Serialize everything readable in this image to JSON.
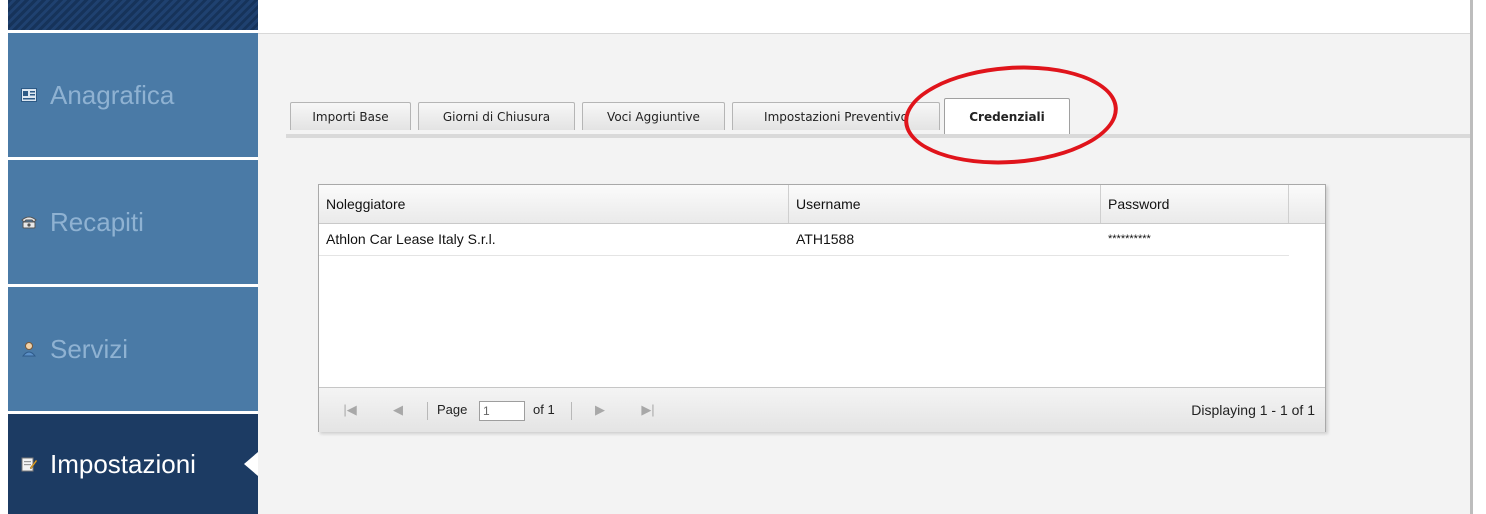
{
  "sidebar": {
    "items": [
      {
        "label": "Anagrafica",
        "icon": "id-card-icon"
      },
      {
        "label": "Recapiti",
        "icon": "phone-icon"
      },
      {
        "label": "Servizi",
        "icon": "person-icon"
      },
      {
        "label": "Impostazioni",
        "icon": "edit-note-icon",
        "active": true
      }
    ]
  },
  "tabs": [
    {
      "label": "Importi Base"
    },
    {
      "label": "Giorni di Chiusura"
    },
    {
      "label": "Voci Aggiuntive"
    },
    {
      "label": "Impostazioni Preventivo"
    },
    {
      "label": "Credenziali",
      "active": true
    }
  ],
  "grid": {
    "columns": [
      "Noleggiatore",
      "Username",
      "Password"
    ],
    "rows": [
      [
        "Athlon Car Lease Italy S.r.l.",
        "ATH1588",
        "**********"
      ]
    ]
  },
  "paging": {
    "page_label": "Page",
    "page_value": "1",
    "of_label": "of 1",
    "display_text": "Displaying 1 - 1 of 1"
  },
  "colors": {
    "sidebar_bg": "#4a7aa6",
    "sidebar_active_bg": "#1c3b63",
    "annotation": "#e0141b"
  }
}
